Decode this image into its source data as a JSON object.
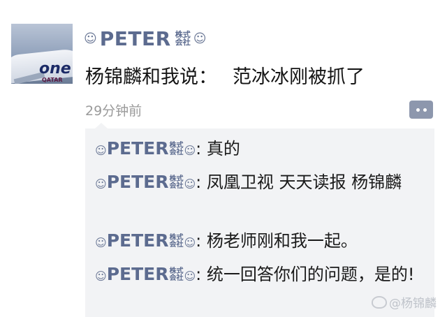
{
  "post": {
    "author_prefix": "☺",
    "author_name": "PETER",
    "author_kaisha_top": "株式",
    "author_kaisha_bottom": "会社",
    "author_suffix": "☺",
    "text_part1": "杨锦麟和我说：",
    "text_part2": "范冰冰刚被抓了",
    "time": "29分钟前"
  },
  "comments": [
    {
      "prefix": "☺",
      "name": "PETER",
      "kaisha_top": "株式",
      "kaisha_bottom": "会社",
      "suffix": "☺",
      "text": ": 真的"
    },
    {
      "prefix": "☺",
      "name": "PETER",
      "kaisha_top": "株式",
      "kaisha_bottom": "会社",
      "suffix": "☺",
      "text": ": 凤凰卫视 天天读报 杨锦麟"
    },
    {
      "prefix": "☺",
      "name": "PETER",
      "kaisha_top": "株式",
      "kaisha_bottom": "会社",
      "suffix": "☺",
      "text": ": 杨老师刚和我一起。"
    },
    {
      "prefix": "☺",
      "name": "PETER",
      "kaisha_top": "株式",
      "kaisha_bottom": "会社",
      "suffix": "☺",
      "text": ": 统一回答你们的问题，是的!"
    }
  ],
  "avatar": {
    "logo_text": "one",
    "logo_sub": "QATAR"
  },
  "watermark": {
    "text": "@杨锦麟"
  },
  "icons": {
    "comment_button": "more-dots-icon",
    "avatar": "airplane-avatar"
  },
  "colors": {
    "name_color": "#5c6b8f",
    "comment_bg": "#f2f3f5",
    "button_bg": "#8d97ad",
    "time_color": "#9a9a9a"
  }
}
